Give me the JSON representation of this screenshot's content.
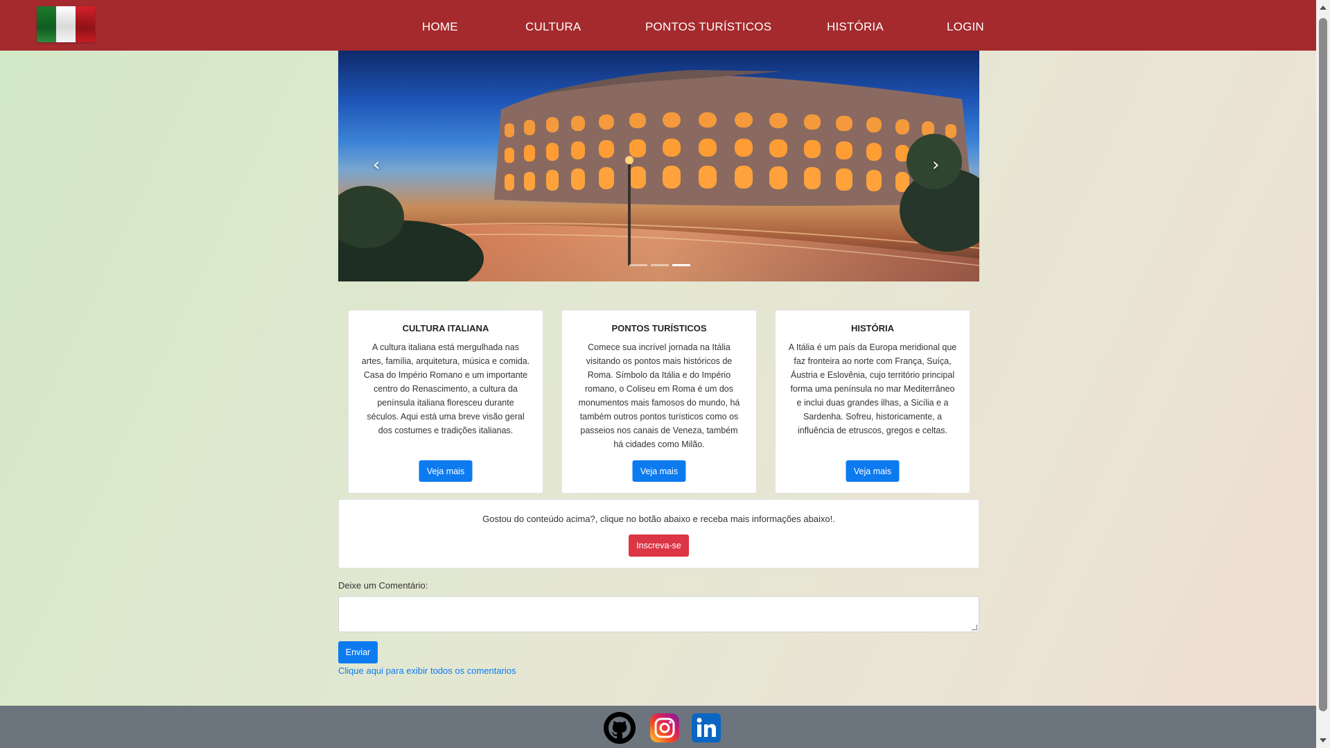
{
  "nav": {
    "items": [
      {
        "label": "HOME"
      },
      {
        "label": "CULTURA"
      },
      {
        "label": "PONTOS TURÍSTICOS"
      },
      {
        "label": "HISTÓRIA"
      },
      {
        "label": "LOGIN"
      }
    ]
  },
  "carousel": {
    "prev_icon": "chevron-left-icon",
    "next_icon": "chevron-right-icon",
    "prev_glyph": "‹",
    "next_glyph": "›",
    "slide_count": 3,
    "active_slide": 3
  },
  "cards": [
    {
      "title": "CULTURA ITALIANA",
      "text": "A cultura italiana está mergulhada nas artes, família, arquitetura, música e comida. Casa do Império Romano e um importante centro do Renascimento, a cultura da península italiana floresceu durante séculos. Aqui está uma breve visão geral dos costumes e tradições italianas.",
      "button": "Veja mais"
    },
    {
      "title": "PONTOS TURÍSTICOS",
      "text": "Comece sua incrível jornada na Itália visitando os pontos mais históricos de Roma. Símbolo da Itália e do Império romano, o Coliseu em Roma é um dos monumentos mais famosos do mundo, há também outros pontos turísticos como os passeios nos canais de Veneza, também há cidades como Milão.",
      "button": "Veja mais"
    },
    {
      "title": "HISTÓRIA",
      "text": "A Itália é um país da Europa meridional que faz fronteira ao norte com França, Suíça, Áustria e Eslovênia, cujo território principal forma uma península no mar Mediterrâneo e inclui duas grandes ilhas, a Sicília e a Sardenha. Sofreu, historicamente, a influência de etruscos, gregos e celtas.",
      "button": "Veja mais"
    }
  ],
  "subscribe": {
    "text": "Gostou do conteúdo acima?, clique no botão abaixo e receba mais informações abaixo!.",
    "button": "Inscreva-se"
  },
  "comment": {
    "label": "Deixe um Comentário:",
    "value": "",
    "submit": "Enviar",
    "show_all_link": "Clique aqui para exibir todos os comentarios"
  },
  "footer": {
    "icons": [
      "github-icon",
      "instagram-icon",
      "linkedin-icon"
    ]
  },
  "colors": {
    "navbar": "#a42a2d",
    "primary": "#0d7bf0",
    "danger": "#dc3545",
    "footer": "#6c757d"
  }
}
